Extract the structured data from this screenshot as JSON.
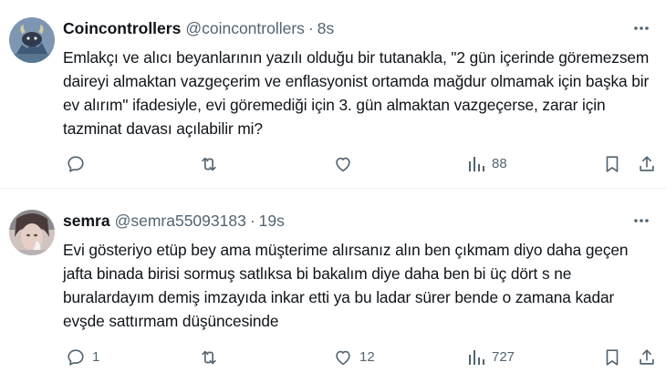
{
  "tweets": [
    {
      "author": {
        "display_name": "Coincontrollers",
        "handle": "@coincontrollers",
        "avatar_icon": "avatar-bull-illustration"
      },
      "separator": "·",
      "time": "8s",
      "text": "Emlakçı ve alıcı beyanlarının yazılı olduğu bir tutanakla, \"2 gün içerinde göremezsem daireyi almaktan vazgeçerim ve enflasyonist ortamda mağdur olmamak için başka bir ev alırım\" ifadesiyle, evi göremediği için 3. gün almaktan vazgeçerse, zarar için tazminat davası açılabilir mi?",
      "stats": {
        "replies": "",
        "retweets": "",
        "likes": "",
        "views": "88"
      }
    },
    {
      "author": {
        "display_name": "semra",
        "handle": "@semra55093183",
        "avatar_icon": "avatar-photo"
      },
      "separator": "·",
      "time": "19s",
      "text": "Evi  gösteriyo etüp bey ama müşterime alırsanız alın ben çıkmam diyo daha geçen jafta binada birisi sormuş satlıksa bi bakalım diye daha ben bi üç dört s ne buralardayım demiş imzayıda inkar etti ya bu ladar sürer bende o zamana kadar evşde sattırmam düşüncesinde",
      "stats": {
        "replies": "1",
        "retweets": "",
        "likes": "12",
        "views": "727"
      }
    }
  ],
  "colors": {
    "text": "#0f1419",
    "secondary": "#536471",
    "divider": "#eff3f4"
  }
}
